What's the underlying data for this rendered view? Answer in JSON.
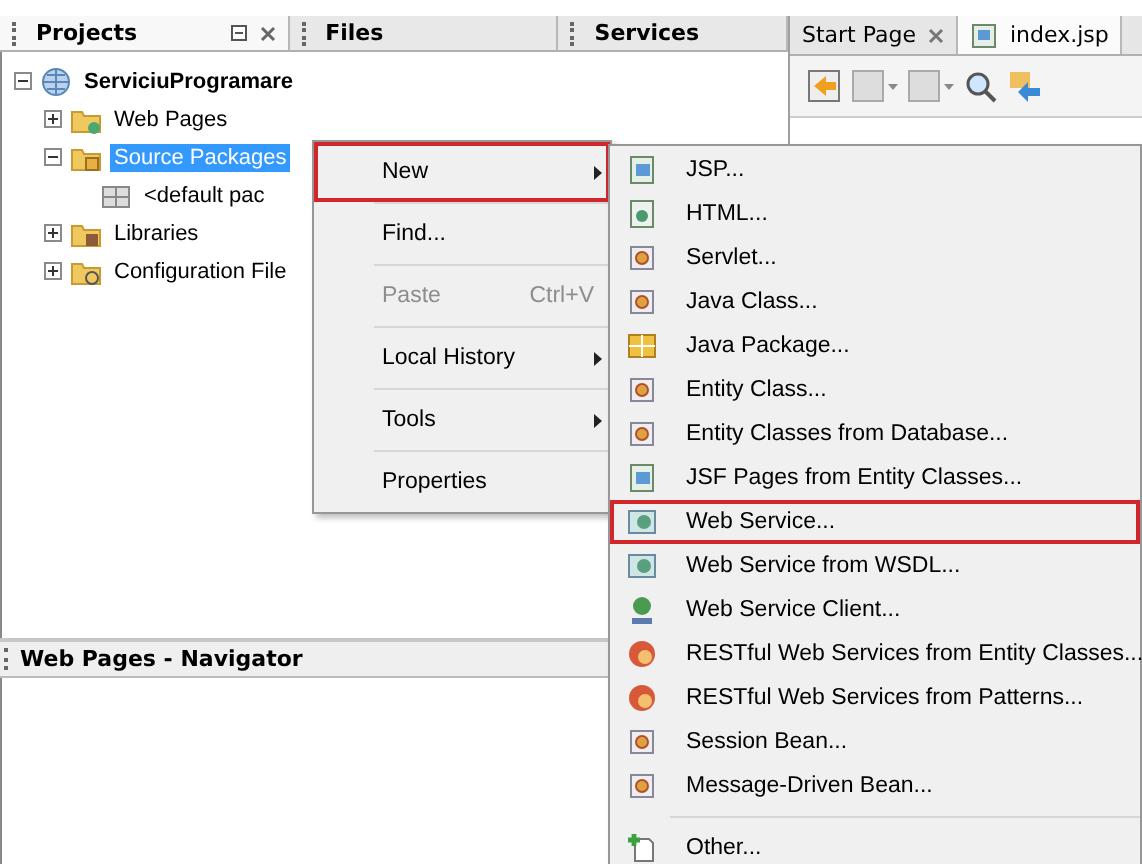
{
  "project_tabs": [
    {
      "label": "Projects",
      "selected": true
    },
    {
      "label": "Files",
      "selected": false
    },
    {
      "label": "Services",
      "selected": false
    }
  ],
  "editor_tabs": [
    {
      "label": "Start Page",
      "selected": false
    },
    {
      "label": "index.jsp",
      "selected": true
    }
  ],
  "tree": [
    {
      "label": "ServiciuProgramare",
      "kind": "project",
      "expanded": true,
      "selected": false,
      "children": [
        {
          "label": "Web Pages",
          "kind": "web-folder",
          "expanded": false,
          "selected": false
        },
        {
          "label": "Source Packages",
          "kind": "source-folder",
          "expanded": true,
          "selected": true,
          "children": [
            {
              "label": "<default pac",
              "kind": "package",
              "selected": false
            }
          ]
        },
        {
          "label": "Libraries",
          "kind": "library-folder",
          "expanded": false,
          "selected": false
        },
        {
          "label": "Configuration File",
          "kind": "config-folder",
          "expanded": false,
          "selected": false
        }
      ]
    }
  ],
  "navigator": {
    "title": "Web Pages - Navigator"
  },
  "context_menu": [
    {
      "label": "New",
      "submenu": true,
      "disabled": false,
      "selected": true
    },
    {
      "label": "Find...",
      "submenu": false,
      "disabled": false,
      "selected": false
    },
    {
      "label": "Paste",
      "shortcut": "Ctrl+V",
      "submenu": false,
      "disabled": true,
      "selected": false
    },
    {
      "label": "Local History",
      "submenu": true,
      "disabled": false,
      "selected": false
    },
    {
      "label": "Tools",
      "submenu": true,
      "disabled": false,
      "selected": false
    },
    {
      "label": "Properties",
      "submenu": false,
      "disabled": false,
      "selected": false
    }
  ],
  "new_submenu": [
    {
      "label": "JSP...",
      "kind": "jsp",
      "selected": false
    },
    {
      "label": "HTML...",
      "kind": "html",
      "selected": false
    },
    {
      "label": "Servlet...",
      "kind": "class",
      "selected": false
    },
    {
      "label": "Java Class...",
      "kind": "class",
      "selected": false
    },
    {
      "label": "Java Package...",
      "kind": "package",
      "selected": false
    },
    {
      "label": "Entity Class...",
      "kind": "class",
      "selected": false
    },
    {
      "label": "Entity Classes from Database...",
      "kind": "class",
      "selected": false
    },
    {
      "label": "JSF Pages from Entity Classes...",
      "kind": "jsp",
      "selected": false
    },
    {
      "label": "Web Service...",
      "kind": "service",
      "selected": true
    },
    {
      "label": "Web Service from WSDL...",
      "kind": "service",
      "selected": false
    },
    {
      "label": "Web Service Client...",
      "kind": "client",
      "selected": false
    },
    {
      "label": "RESTful Web Services from Entity Classes...",
      "kind": "rest",
      "selected": false
    },
    {
      "label": "RESTful Web Services from Patterns...",
      "kind": "rest",
      "selected": false
    },
    {
      "label": "Session Bean...",
      "kind": "class",
      "selected": false
    },
    {
      "label": "Message-Driven Bean...",
      "kind": "class",
      "selected": false
    },
    {
      "kind": "separator"
    },
    {
      "label": "Other...",
      "kind": "other",
      "selected": false
    }
  ]
}
